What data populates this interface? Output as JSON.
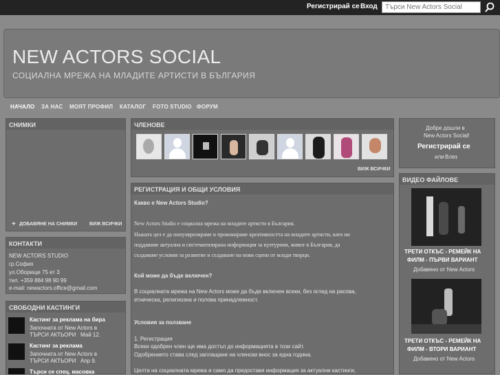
{
  "topbar": {
    "register": "Регистрирай се",
    "login": "Вход",
    "search_placeholder": "Търси New Actors Social"
  },
  "site": {
    "title": "NEW ACTORS SOCIAL",
    "tagline": "СОЦИАЛНА МРЕЖА НА МЛАДИТЕ АРТИСТИ В БЪЛГАРИЯ"
  },
  "nav": [
    "НАЧАЛО",
    "ЗА НАС",
    "МОЯТ ПРОФИЛ",
    "КАТАЛОГ",
    "FOTO STUDIO",
    "ФОРУМ"
  ],
  "photos": {
    "title": "СНИМКИ",
    "add": "ДОБАВЯНЕ НА СНИМКИ",
    "view_all": "ВИЖ ВСИЧКИ"
  },
  "contacts": {
    "title": "КОНТАКТИ",
    "lines": [
      "NEW ACTORS STUDIO",
      "гр.София",
      "ул.Оборище 75 ет 3",
      "тел. +359 884 98 90 99",
      "e-mail: newactors.office@gmail.com"
    ]
  },
  "castings": {
    "title": "СВОБОДНИ КАСТИНГИ",
    "items": [
      {
        "title": "Кастинг за реклама на бира",
        "line1": "Започната от New Actors в",
        "line2": "ТЪРСИ АКТЬОРИ",
        "date": "Май 12."
      },
      {
        "title": "Кастинг за реклама",
        "line1": "Започната от New Actors в",
        "line2": "ТЪРСИ АКТЬОРИ",
        "date": "Апр 9."
      },
      {
        "title": "Търси се спец. масовка",
        "line1": "",
        "line2": "",
        "date": ""
      }
    ]
  },
  "members": {
    "title": "ЧЛЕНОВЕ",
    "view_all": "ВИЖ ВСИЧКИ"
  },
  "reg": {
    "title": "РЕГИСТРАЦИЯ И ОБЩИ УСЛОВИЯ",
    "q1": "Какво е New Actors Studio?",
    "p1": "New Actors Studio е социална мрежа на младите артисти в България.",
    "p2a": "Нашата цел е да популяризираме и провокираме креативността на младите артисти,  като ни",
    "p2b": "поддаваме актуална и систематизирана информация за културния, живот в България, да",
    "p2c": "създаваме условия за развитие и създаване на нови сцени от млади творци.",
    "q2": "Кой може да бъде включен?",
    "p3a": "В социалната мрежа на New Actors може да бъде включен всеки, без оглед на расова,",
    "p3b": "етническа, религиозна и полова принадлежност.",
    "q3": "Условия за ползване",
    "p4a": "1. Регистрация",
    "p4b": "Всеки одобрен член ще има достъп до информацията в този сайт.",
    "p4c": "Одобрението става след заплащане на членски внос за една година.",
    "p5": "Целта на социалната мрежа и само да предоставя информация за актуални кастинги,"
  },
  "welcome": {
    "line1": "Добре дошли в",
    "line2": "New Actors Social!",
    "register": "Регистрирай се",
    "or": "или",
    "login": "Влез"
  },
  "videos": {
    "title": "ВИДЕО ФАЙЛОВЕ",
    "items": [
      {
        "title1": "ТРЕТИ ОТКЪС - РЕМЕЙК НА",
        "title2": "ФИЛМ - ПЪРВИ ВАРИАНТ",
        "by": "Добавено от New Actors"
      },
      {
        "title1": "ТРЕТИ ОТКЪС - РЕМЕЙК НА",
        "title2": "ФИЛМ - ВТОРИ ВАРИАНТ",
        "by": "Добавено от New Actors"
      }
    ]
  }
}
